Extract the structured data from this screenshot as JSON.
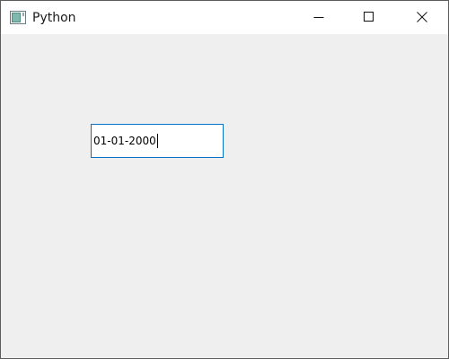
{
  "window": {
    "title": "Python",
    "icon": "app-window-icon",
    "controls": {
      "minimize": "minimize-icon",
      "maximize": "maximize-icon",
      "close": "close-icon"
    }
  },
  "date_edit": {
    "value": "01-01-2000"
  },
  "colors": {
    "background": "#efefef",
    "titlebar": "#ffffff",
    "input_border": "#0a72c4"
  }
}
